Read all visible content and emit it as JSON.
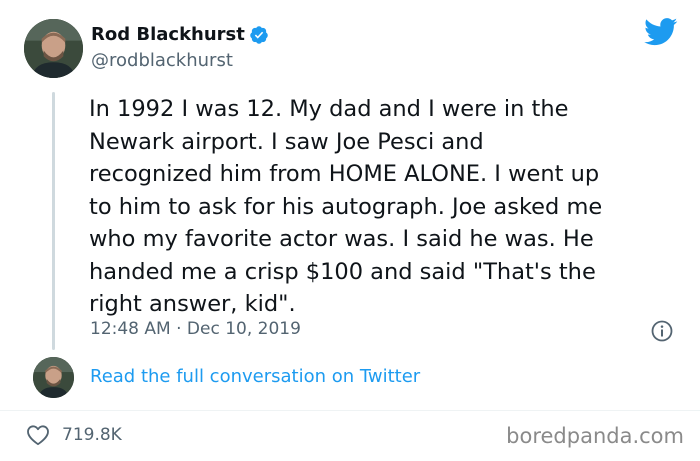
{
  "author": {
    "display_name": "Rod Blackhurst",
    "handle": "@rodblackhurst",
    "verified": true
  },
  "tweet": {
    "text": "In 1992 I was 12. My dad and I were in the\nNewark airport. I saw Joe Pesci and\nrecognized him from HOME ALONE. I went up\nto him to ask for his autograph. Joe asked me\nwho my favorite actor was. I said he was. He\nhanded me a crisp $100 and said \"That's the\nright answer, kid\".",
    "timestamp": "12:48 AM · Dec 10, 2019"
  },
  "actions": {
    "read_conversation": "Read the full conversation on Twitter",
    "likes": "719.8K"
  },
  "watermark": "boredpanda.com",
  "icons": {
    "platform": "twitter-bird-icon",
    "verified": "verified-badge-icon",
    "info": "info-icon",
    "like": "heart-icon"
  },
  "colors": {
    "accent": "#1d9bf0",
    "text_primary": "#0f1419",
    "text_secondary": "#536471"
  }
}
